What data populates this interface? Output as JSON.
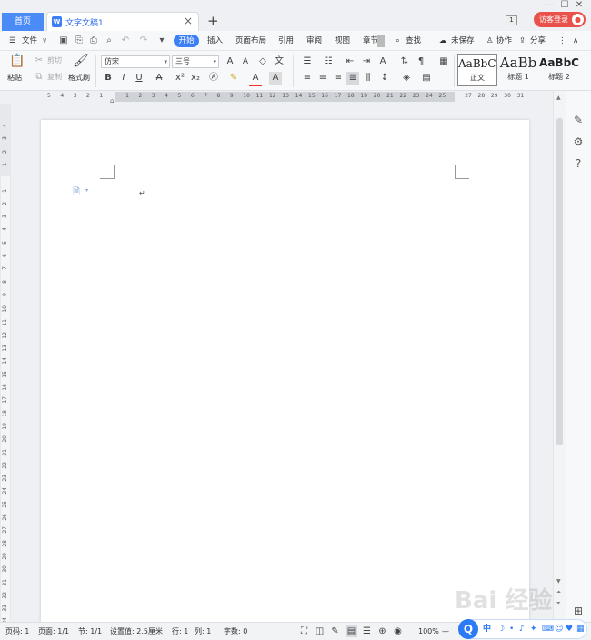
{
  "tabs": {
    "home_label": "首页",
    "doc_icon": "W",
    "doc_title": "文字文稿1",
    "close": "×",
    "add": "+"
  },
  "window": {
    "count": "1",
    "visitor_label": "访客登录",
    "minimize": "—",
    "maximize": "☐",
    "close": "✕"
  },
  "menu": {
    "file": "文件",
    "start": "开始",
    "insert": "插入",
    "layout": "页面布局",
    "references": "引用",
    "review": "审阅",
    "view": "视图",
    "chapter": "章节",
    "search": "查找",
    "unsaved": "未保存",
    "collab": "协作",
    "share": "分享"
  },
  "ribbon": {
    "paste": "粘贴",
    "cut": "剪切",
    "copy": "复制",
    "format_painter": "格式刷",
    "font_name": "仿宋",
    "font_size": "三号",
    "bold": "B",
    "italic": "I",
    "underline": "U",
    "styles": [
      {
        "sample": "AaBbCcI",
        "label": "正文"
      },
      {
        "sample": "AaBb",
        "label": "标题 1"
      },
      {
        "sample": "AaBbC",
        "label": "标题 2"
      }
    ]
  },
  "ruler": {
    "h_ticks": [
      "5",
      "4",
      "3",
      "2",
      "1",
      "",
      "1",
      "2",
      "3",
      "4",
      "5",
      "6",
      "7",
      "8",
      "9",
      "10",
      "11",
      "12",
      "13",
      "14",
      "15",
      "16",
      "17",
      "18",
      "19",
      "20",
      "21",
      "22",
      "23",
      "24",
      "25",
      "",
      "27",
      "28",
      "29",
      "30",
      "31"
    ],
    "v_ticks": [
      "4",
      "3",
      "2",
      "1",
      "",
      "1",
      "2",
      "3",
      "4",
      "5",
      "6",
      "7",
      "8",
      "9",
      "10",
      "11",
      "12",
      "13",
      "14",
      "15",
      "16",
      "17",
      "18",
      "19",
      "20",
      "21",
      "22",
      "23",
      "24",
      "25",
      "26",
      "27",
      "28",
      "29",
      "30",
      "31",
      "32",
      "33",
      "34",
      "35"
    ]
  },
  "document": {
    "paragraph_mark": "↵"
  },
  "statusbar": {
    "page_code": "页码: 1",
    "page": "页面: 1/1",
    "section": "节: 1/1",
    "setting": "设置值: 2.5厘米",
    "row": "行: 1",
    "col": "列: 1",
    "words": "字数: 0",
    "zoom": "100%",
    "zoom_minus": "—"
  },
  "ime": {
    "logo": "Q",
    "mode": "中"
  },
  "watermark": "Bai 经验"
}
